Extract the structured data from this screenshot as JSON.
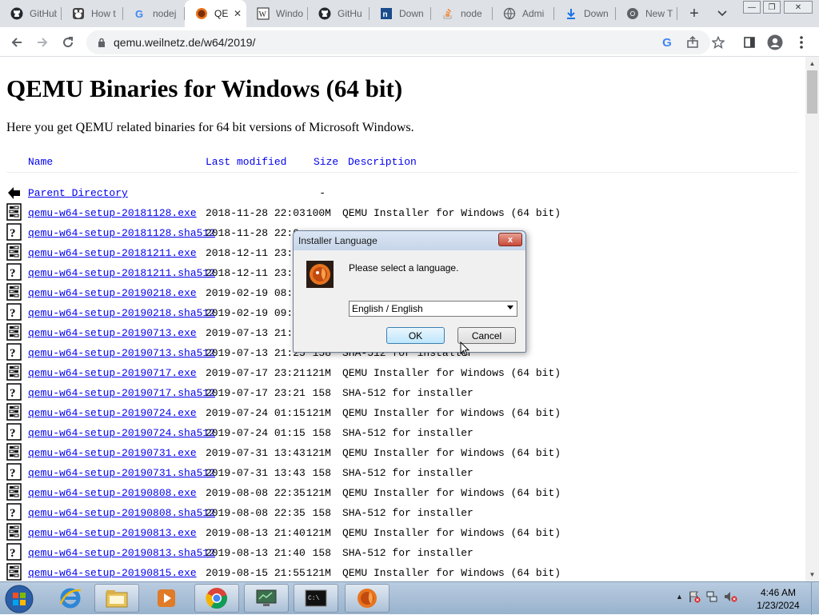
{
  "browser": {
    "tabs": [
      {
        "title": "GitHub",
        "icon": "github-icon",
        "active": false
      },
      {
        "title": "How t",
        "icon": "bear-icon",
        "active": false
      },
      {
        "title": "nodej",
        "icon": "google-icon",
        "active": false
      },
      {
        "title": "QE",
        "icon": "qemu-icon",
        "active": true
      },
      {
        "title": "Windo",
        "icon": "wikipedia-icon",
        "active": false
      },
      {
        "title": "GitHu",
        "icon": "github-icon",
        "active": false
      },
      {
        "title": "Down",
        "icon": "nodejs-icon",
        "active": false
      },
      {
        "title": "node",
        "icon": "stack-overflow-icon",
        "active": false
      },
      {
        "title": "Admi",
        "icon": "globe-icon",
        "active": false
      },
      {
        "title": "Down",
        "icon": "download-icon",
        "active": false
      },
      {
        "title": "New T",
        "icon": "chrome-icon",
        "active": false
      }
    ],
    "url": "qemu.weilnetz.de/w64/2019/"
  },
  "page": {
    "title": "QEMU Binaries for Windows (64 bit)",
    "intro": "Here you get QEMU related binaries for 64 bit versions of Microsoft Windows.",
    "columns": {
      "name": "Name",
      "modified": "Last modified",
      "size": "Size",
      "description": "Description"
    },
    "parent": {
      "name": "Parent Directory",
      "size": "-"
    },
    "rows": [
      {
        "name": "qemu-w64-setup-20181128.exe",
        "modified": "2018-11-28 22:03",
        "size": "100M",
        "desc": "QEMU Installer for Windows (64 bit)",
        "kind": "exe"
      },
      {
        "name": "qemu-w64-setup-20181128.sha512",
        "modified": "2018-11-28 22:0",
        "size": "",
        "desc": "",
        "kind": "sha"
      },
      {
        "name": "qemu-w64-setup-20181211.exe",
        "modified": "2018-12-11 23:5",
        "size": "",
        "desc": "it)",
        "kind": "exe"
      },
      {
        "name": "qemu-w64-setup-20181211.sha512",
        "modified": "2018-12-11 23:5",
        "size": "",
        "desc": "",
        "kind": "sha"
      },
      {
        "name": "qemu-w64-setup-20190218.exe",
        "modified": "2019-02-19 08:1",
        "size": "",
        "desc": "it)",
        "kind": "exe"
      },
      {
        "name": "qemu-w64-setup-20190218.sha512",
        "modified": "2019-02-19 09:5",
        "size": "",
        "desc": "",
        "kind": "sha"
      },
      {
        "name": "qemu-w64-setup-20190713.exe",
        "modified": "2019-07-13 21:2",
        "size": "",
        "desc": "it)",
        "kind": "exe"
      },
      {
        "name": "qemu-w64-setup-20190713.sha512",
        "modified": "2019-07-13 21:25",
        "size": "158",
        "desc": "SHA-512 for installer",
        "kind": "sha"
      },
      {
        "name": "qemu-w64-setup-20190717.exe",
        "modified": "2019-07-17 23:21",
        "size": "121M",
        "desc": "QEMU Installer for Windows (64 bit)",
        "kind": "exe"
      },
      {
        "name": "qemu-w64-setup-20190717.sha512",
        "modified": "2019-07-17 23:21",
        "size": "158",
        "desc": "SHA-512 for installer",
        "kind": "sha"
      },
      {
        "name": "qemu-w64-setup-20190724.exe",
        "modified": "2019-07-24 01:15",
        "size": "121M",
        "desc": "QEMU Installer for Windows (64 bit)",
        "kind": "exe"
      },
      {
        "name": "qemu-w64-setup-20190724.sha512",
        "modified": "2019-07-24 01:15",
        "size": "158",
        "desc": "SHA-512 for installer",
        "kind": "sha"
      },
      {
        "name": "qemu-w64-setup-20190731.exe",
        "modified": "2019-07-31 13:43",
        "size": "121M",
        "desc": "QEMU Installer for Windows (64 bit)",
        "kind": "exe"
      },
      {
        "name": "qemu-w64-setup-20190731.sha512",
        "modified": "2019-07-31 13:43",
        "size": "158",
        "desc": "SHA-512 for installer",
        "kind": "sha"
      },
      {
        "name": "qemu-w64-setup-20190808.exe",
        "modified": "2019-08-08 22:35",
        "size": "121M",
        "desc": "QEMU Installer for Windows (64 bit)",
        "kind": "exe"
      },
      {
        "name": "qemu-w64-setup-20190808.sha512",
        "modified": "2019-08-08 22:35",
        "size": "158",
        "desc": "SHA-512 for installer",
        "kind": "sha"
      },
      {
        "name": "qemu-w64-setup-20190813.exe",
        "modified": "2019-08-13 21:40",
        "size": "121M",
        "desc": "QEMU Installer for Windows (64 bit)",
        "kind": "exe"
      },
      {
        "name": "qemu-w64-setup-20190813.sha512",
        "modified": "2019-08-13 21:40",
        "size": "158",
        "desc": "SHA-512 for installer",
        "kind": "sha"
      },
      {
        "name": "qemu-w64-setup-20190815.exe",
        "modified": "2019-08-15 21:55",
        "size": "121M",
        "desc": "QEMU Installer for Windows (64 bit)",
        "kind": "exe"
      }
    ]
  },
  "dialog": {
    "title": "Installer Language",
    "message": "Please select a language.",
    "selected_language": "English / English",
    "ok_label": "OK",
    "cancel_label": "Cancel",
    "close_label": "x"
  },
  "taskbar": {
    "time": "4:46 AM",
    "date": "1/23/2024"
  },
  "colors": {
    "link": "#0000ee",
    "tabstrip": "#dee1e6",
    "taskbar": "#98b2cd"
  }
}
